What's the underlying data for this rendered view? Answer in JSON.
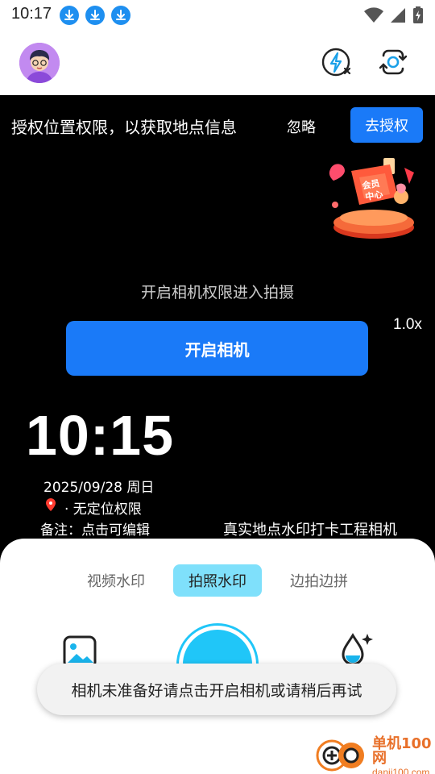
{
  "status_bar": {
    "time": "10:17",
    "icons": [
      "download-icon",
      "download-icon",
      "download-icon",
      "wifi-icon",
      "signal-icon",
      "battery-icon"
    ]
  },
  "header": {
    "icons": [
      "avatar",
      "flash-off-icon",
      "switch-camera-icon"
    ]
  },
  "permission": {
    "text": "授权位置权限，以获取地点信息",
    "ignore_label": "忽略",
    "authorize_label": "去授权"
  },
  "member": {
    "badge_text": "会员中心"
  },
  "camera": {
    "hint": "开启相机权限进入拍摄",
    "open_label": "开启相机",
    "zoom": "1.0x"
  },
  "watermark": {
    "time": "10:15",
    "date": "2025/09/28 周日",
    "location": "· 无定位权限",
    "note": "备注：点击可编辑",
    "brand": "真实地点水印打卡工程相机"
  },
  "modes": {
    "tabs": [
      "视频水印",
      "拍照水印",
      "边拍边拼"
    ],
    "active_index": 1
  },
  "toast": {
    "message": "相机未准备好请点击开启相机或请稍后再试"
  },
  "site_watermark": {
    "name": "单机100网",
    "url": "danji100.com"
  },
  "colors": {
    "accent": "#1a7af8",
    "active_tab": "#7fe0fb",
    "shutter": "#20c6f8"
  }
}
